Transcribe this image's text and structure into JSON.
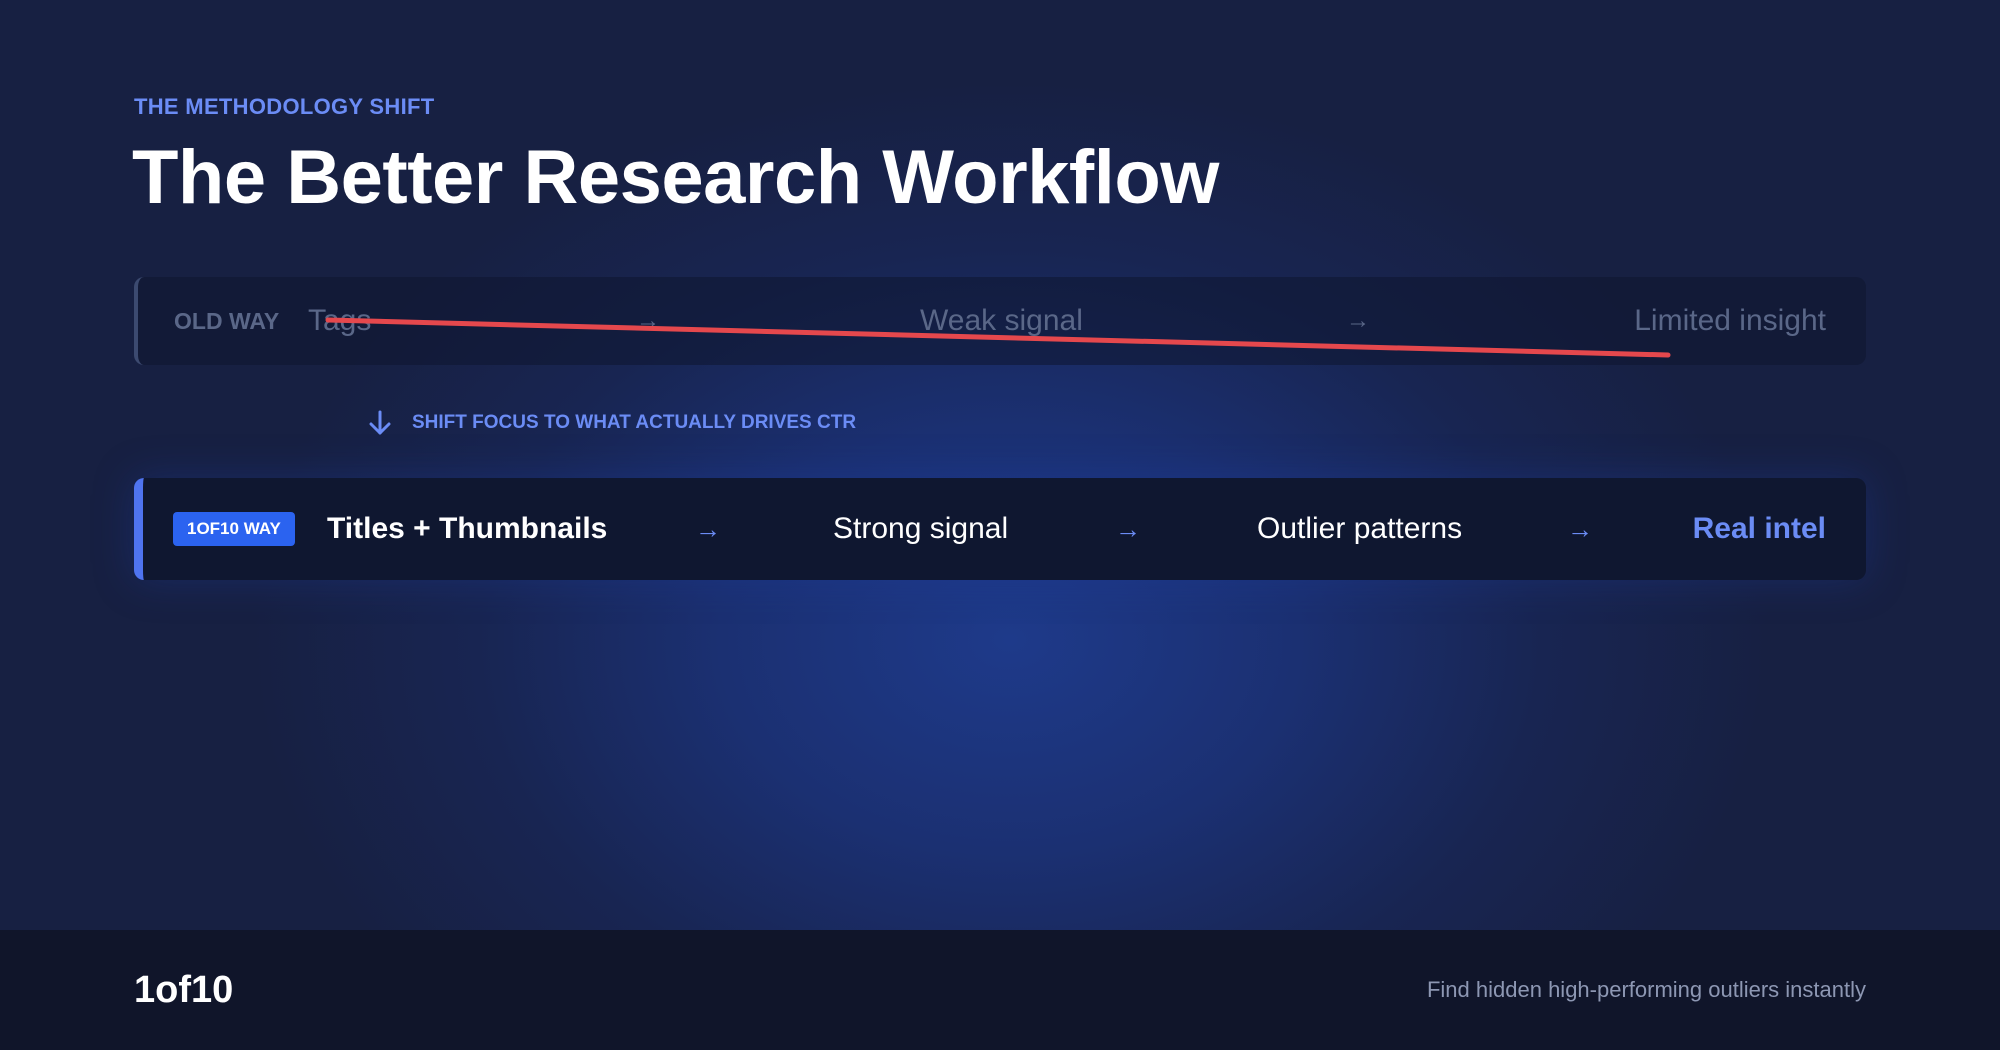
{
  "header": {
    "eyebrow": "THE METHODOLOGY SHIFT",
    "title": "The Better Research Workflow"
  },
  "old_way": {
    "label": "OLD WAY",
    "steps": [
      "Tags",
      "Weak signal",
      "Limited insight"
    ],
    "arrow_icon": "arrow-right-icon",
    "strike_color": "#e5484d"
  },
  "shift": {
    "icon": "arrow-down-icon",
    "text": "SHIFT FOCUS TO WHAT ACTUALLY DRIVES CTR"
  },
  "new_way": {
    "badge": "1OF10 WAY",
    "steps": [
      "Titles + Thumbnails",
      "Strong signal",
      "Outlier patterns",
      "Real intel"
    ],
    "arrow_icon": "arrow-right-icon",
    "accent_color": "#6b8cf5"
  },
  "footer": {
    "brand": "1of10",
    "tagline": "Find hidden high-performing outliers instantly"
  }
}
